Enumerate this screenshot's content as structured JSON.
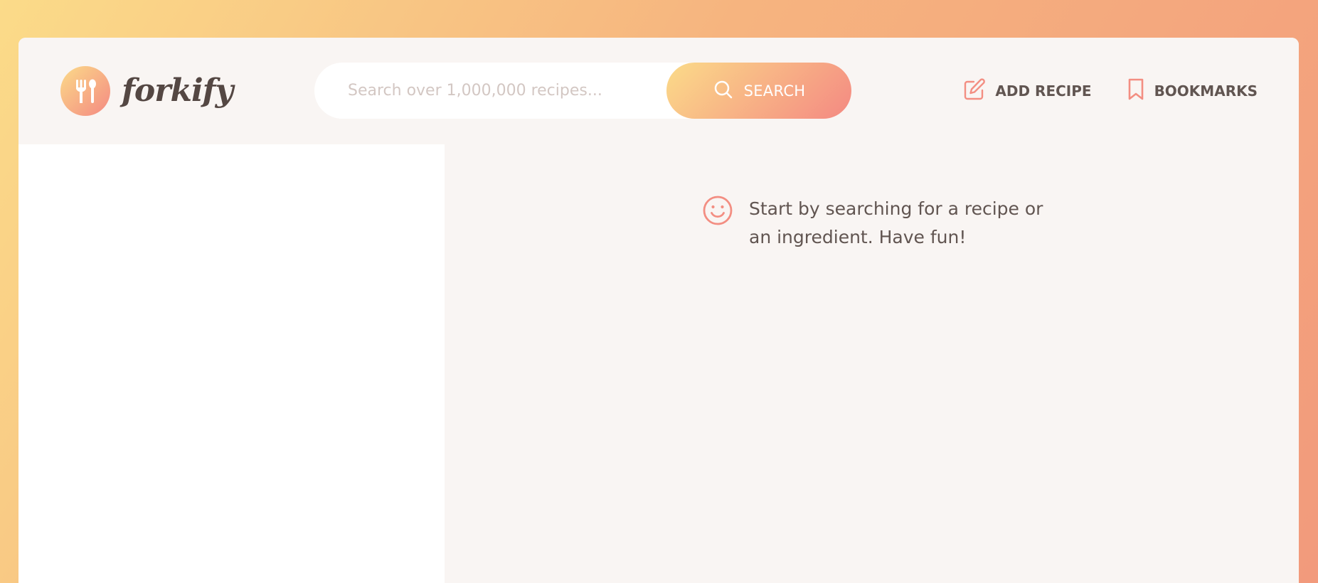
{
  "app": {
    "logo_text": "forkify"
  },
  "search": {
    "placeholder": "Search over 1,000,000 recipes...",
    "button_label": "SEARCH"
  },
  "nav": {
    "add_recipe_label": "ADD RECIPE",
    "bookmarks_label": "BOOKMARKS"
  },
  "recipe": {
    "message": "Start by searching for a recipe or an ingredient. Have fun!"
  },
  "colors": {
    "accent_gradient_start": "#fbdb89",
    "accent_gradient_end": "#f48982",
    "accent_icon": "#f38e82",
    "text": "#615551",
    "panel_bg": "#f9f5f3"
  },
  "icons": {
    "logo": "fork-spoon-icon",
    "search": "search-icon",
    "add_recipe": "edit-icon",
    "bookmarks": "bookmark-icon",
    "message": "smile-icon"
  }
}
